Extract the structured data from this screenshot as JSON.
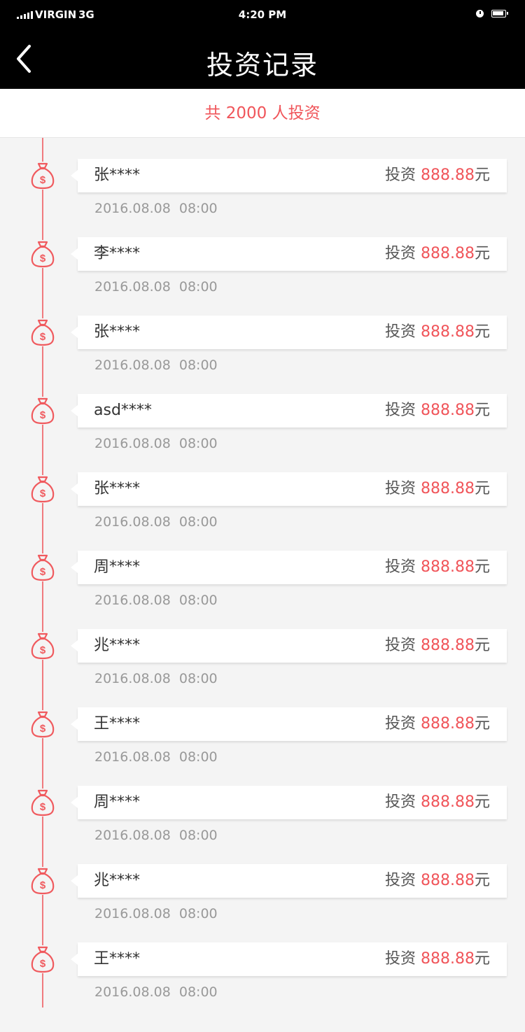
{
  "status_bar": {
    "carrier": "VIRGIN",
    "network": "3G",
    "time": "4:20 PM"
  },
  "header": {
    "title": "投资记录",
    "back_icon": "chevron-left-icon"
  },
  "summary": {
    "text": "共 2000 人投资"
  },
  "colors": {
    "accent": "#f0555a",
    "header_bg": "#000000",
    "page_bg": "#f4f4f4"
  },
  "records": [
    {
      "name": "张****",
      "label": "投资",
      "amount": "888.88",
      "unit": "元",
      "date": "2016.08.08  08:00"
    },
    {
      "name": "李****",
      "label": "投资",
      "amount": "888.88",
      "unit": "元",
      "date": "2016.08.08  08:00"
    },
    {
      "name": "张****",
      "label": "投资",
      "amount": "888.88",
      "unit": "元",
      "date": "2016.08.08  08:00"
    },
    {
      "name": "asd****",
      "label": "投资",
      "amount": "888.88",
      "unit": "元",
      "date": "2016.08.08  08:00"
    },
    {
      "name": "张****",
      "label": "投资",
      "amount": "888.88",
      "unit": "元",
      "date": "2016.08.08  08:00"
    },
    {
      "name": "周****",
      "label": "投资",
      "amount": "888.88",
      "unit": "元",
      "date": "2016.08.08  08:00"
    },
    {
      "name": "兆****",
      "label": "投资",
      "amount": "888.88",
      "unit": "元",
      "date": "2016.08.08  08:00"
    },
    {
      "name": "王****",
      "label": "投资",
      "amount": "888.88",
      "unit": "元",
      "date": "2016.08.08  08:00"
    },
    {
      "name": "周****",
      "label": "投资",
      "amount": "888.88",
      "unit": "元",
      "date": "2016.08.08  08:00"
    },
    {
      "name": "兆****",
      "label": "投资",
      "amount": "888.88",
      "unit": "元",
      "date": "2016.08.08  08:00"
    },
    {
      "name": "王****",
      "label": "投资",
      "amount": "888.88",
      "unit": "元",
      "date": "2016.08.08  08:00"
    }
  ]
}
